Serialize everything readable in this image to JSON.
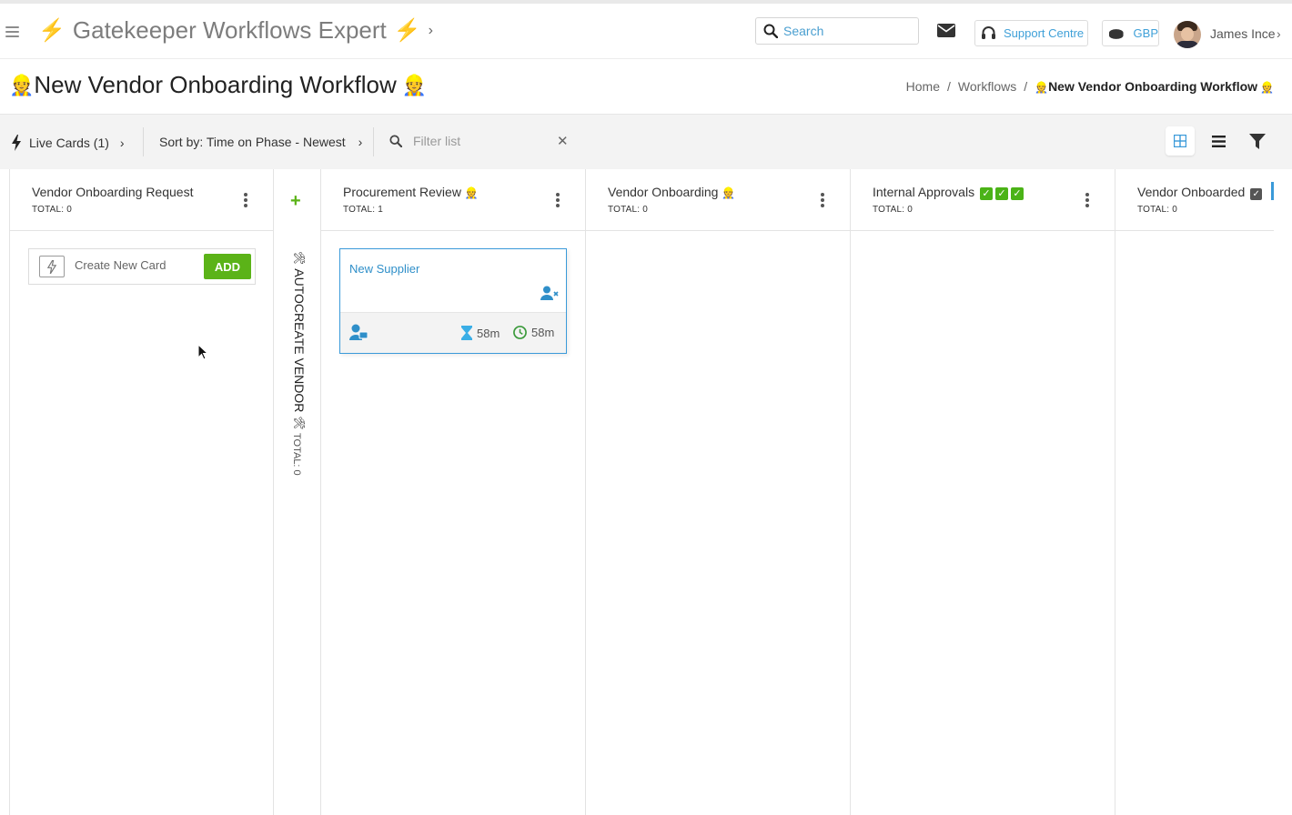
{
  "app": {
    "title": "Gatekeeper Workflows Expert",
    "search_placeholder": "Search",
    "support_label": "Support Centre",
    "currency": "GBP",
    "user_name": "James Ince"
  },
  "page": {
    "title": "New Vendor Onboarding Workflow",
    "breadcrumb": [
      "Home",
      "Workflows",
      "New Vendor Onboarding Workflow"
    ]
  },
  "toolbar": {
    "live_cards": "Live Cards (1)",
    "sort": "Sort by: Time on Phase - Newest",
    "filter_placeholder": "Filter list"
  },
  "columns": [
    {
      "name": "Vendor Onboarding Request",
      "total": "TOTAL: 0"
    },
    {
      "name": "Procurement Review",
      "total": "TOTAL: 1"
    },
    {
      "name": "Vendor Onboarding",
      "total": "TOTAL: 0"
    },
    {
      "name": "Internal Approvals",
      "total": "TOTAL: 0"
    },
    {
      "name": "Vendor Onboarded",
      "total": "TOTAL: 0"
    }
  ],
  "create_card": {
    "placeholder": "Create New Card",
    "add_label": "ADD"
  },
  "automation_column": {
    "name": "AUTOCREATE VENDOR",
    "total": "TOTAL: 0"
  },
  "card": {
    "title": "New Supplier",
    "time_on_phase": "58m",
    "time_total": "58m"
  },
  "colors": {
    "accent_blue": "#3a9ad9",
    "add_green": "#5bb318",
    "bolt_yellow": "#f4b400"
  }
}
